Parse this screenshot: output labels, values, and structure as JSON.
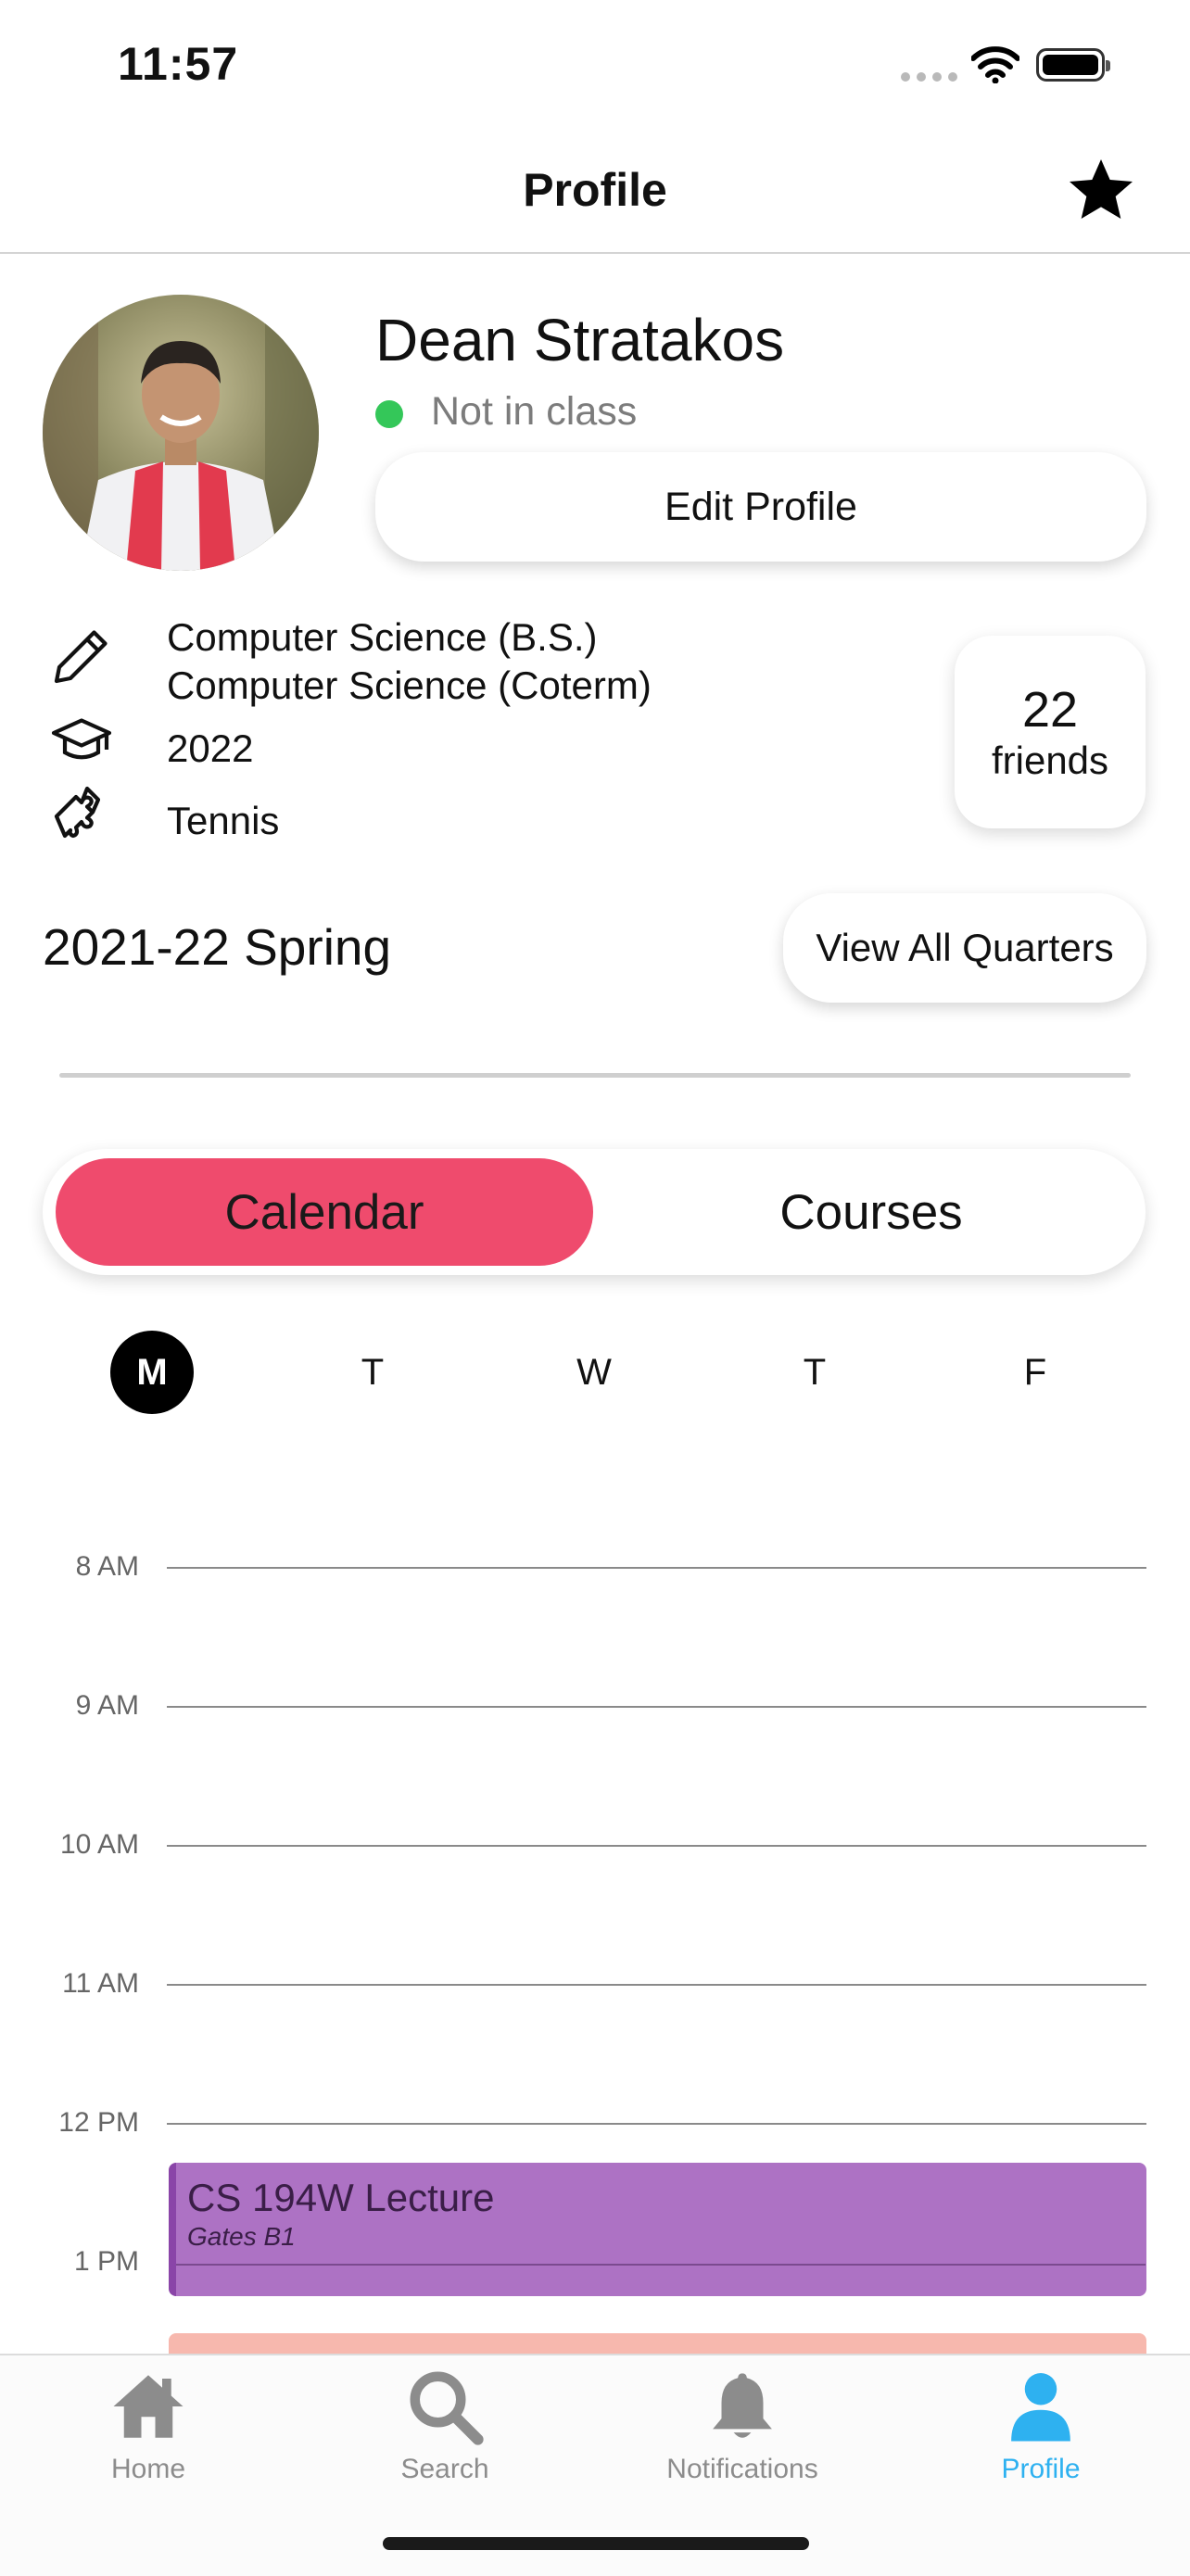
{
  "status_bar": {
    "time": "11:57"
  },
  "nav": {
    "title": "Profile",
    "favorite_icon": "star-icon"
  },
  "profile": {
    "name": "Dean Stratakos",
    "status": "Not in class",
    "status_color": "#34c759",
    "edit_label": "Edit Profile",
    "majors": [
      "Computer Science (B.S.)",
      "Computer Science (Coterm)"
    ],
    "year": "2022",
    "activity": "Tennis",
    "friends_count": "22",
    "friends_label": "friends"
  },
  "quarter": {
    "label": "2021-22 Spring",
    "view_all_label": "View All Quarters"
  },
  "segments": {
    "calendar": "Calendar",
    "courses": "Courses",
    "active": "Calendar",
    "active_color": "#ef4b6d"
  },
  "days": [
    "M",
    "T",
    "W",
    "T",
    "F"
  ],
  "active_day": "M",
  "hours": [
    "8 AM",
    "9 AM",
    "10 AM",
    "11 AM",
    "12 PM",
    "1 PM"
  ],
  "events": [
    {
      "title": "CS 194W Lecture",
      "location": "Gates B1",
      "color": "#ad72c4"
    }
  ],
  "tabs": {
    "home": "Home",
    "search": "Search",
    "notifications": "Notifications",
    "profile": "Profile",
    "active": "Profile",
    "active_color": "#2eb1f0"
  }
}
